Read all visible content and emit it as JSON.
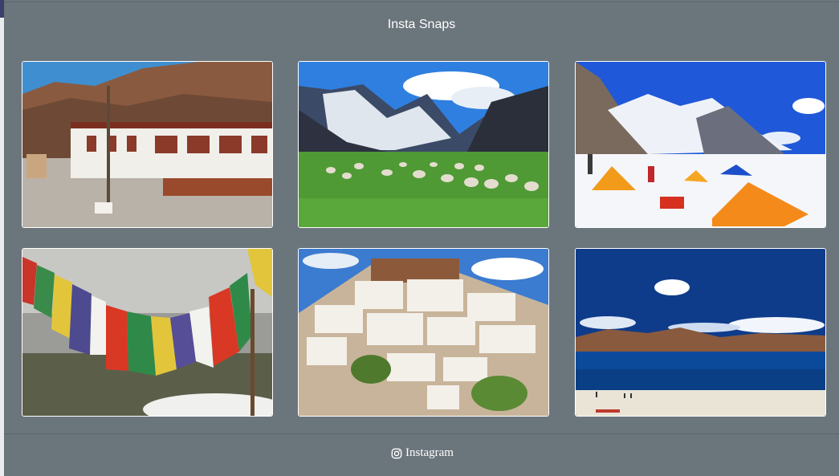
{
  "modal": {
    "title": "Insta Snaps"
  },
  "gallery": {
    "photos": [
      {
        "icon": "monastery-photo"
      },
      {
        "icon": "sheep-valley-photo"
      },
      {
        "icon": "snow-camp-photo"
      },
      {
        "icon": "prayer-flags-photo"
      },
      {
        "icon": "hillside-monastery-photo"
      },
      {
        "icon": "lake-photo"
      }
    ]
  },
  "footer": {
    "link_label": "Instagram",
    "icon": "instagram-icon"
  },
  "colors": {
    "modal_bg": "#6b757c",
    "text": "#ffffff",
    "tile_border": "#ffffff"
  }
}
